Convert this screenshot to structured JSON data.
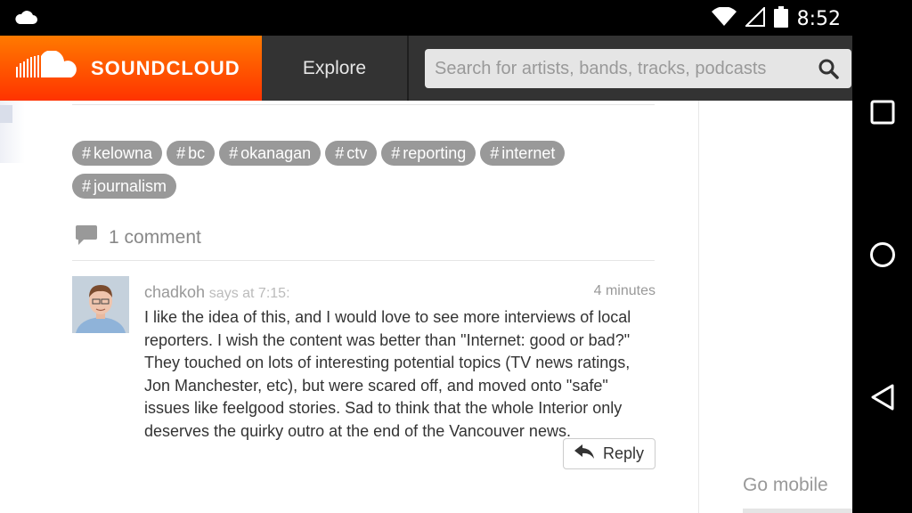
{
  "status_bar": {
    "time": "8:52",
    "icons": [
      "cloud-icon",
      "wifi-icon",
      "signal-icon",
      "battery-icon"
    ]
  },
  "header": {
    "brand": "SOUNDCLOUD",
    "explore_label": "Explore",
    "search_placeholder": "Search for artists, bands, tracks, podcasts",
    "accent_color": "#ff5500"
  },
  "tags": [
    "kelowna",
    "bc",
    "okanagan",
    "ctv",
    "reporting",
    "internet",
    "journalism"
  ],
  "comments": {
    "count_label": "1 comment",
    "items": [
      {
        "user": "chadkoh",
        "says": "says at 7:15:",
        "time_ago": "4 minutes",
        "text": "I like the idea of this, and I would love to see more interviews of local reporters. I wish the content was better than \"Internet: good or bad?\" They touched on lots of interesting potential topics (TV news ratings, Jon Manchester, etc), but were scared off, and moved onto \"safe\" issues like feelgood stories. Sad to think that the whole Interior only deserves the quirky outro at the end of the Vancouver news.",
        "reply_label": "Reply"
      }
    ]
  },
  "sidebar": {
    "go_mobile": "Go mobile"
  }
}
